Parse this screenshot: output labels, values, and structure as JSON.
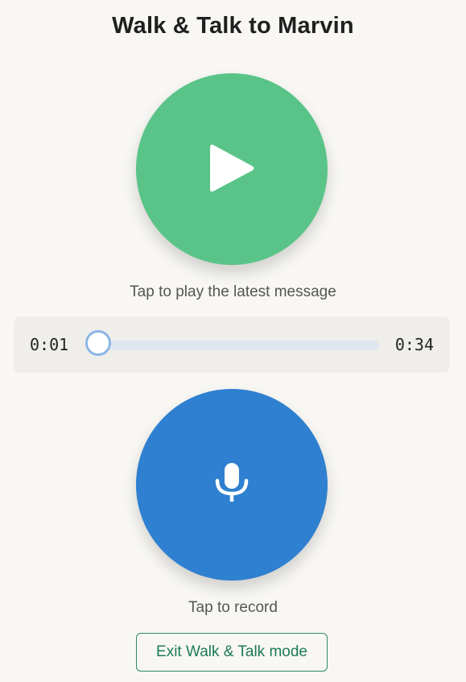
{
  "header": {
    "title": "Walk & Talk to Marvin"
  },
  "player": {
    "play_icon": "play-icon",
    "caption": "Tap to play the latest message",
    "current_time": "0:01",
    "total_time": "0:34",
    "progress_fraction": 0.03
  },
  "recorder": {
    "mic_icon": "microphone-icon",
    "caption": "Tap to record"
  },
  "footer": {
    "exit_label": "Exit Walk & Talk mode"
  },
  "colors": {
    "background": "#f8f7f3",
    "play_green": "#5ac488",
    "record_blue": "#2f80d0",
    "exit_teal": "#1e7a5a",
    "slider_track": "#dfe6ee",
    "slider_thumb_border": "#8ab6e6"
  }
}
